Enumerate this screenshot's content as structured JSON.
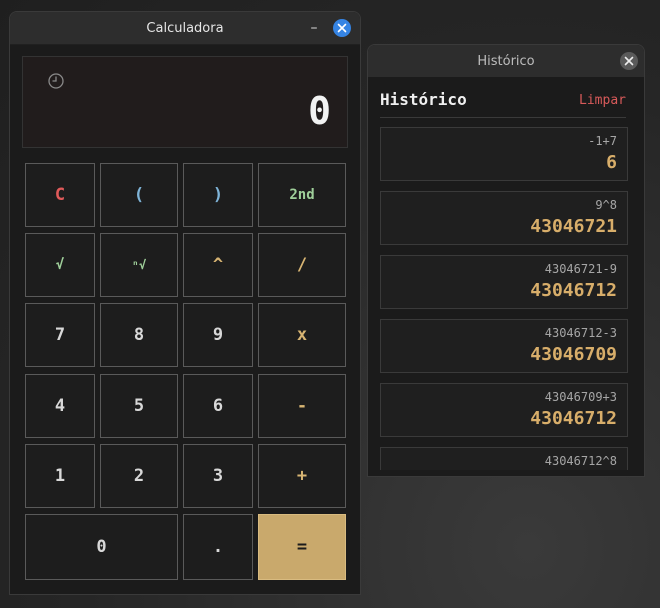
{
  "calculator": {
    "title": "Calculadora",
    "minimize_glyph": "–",
    "close_glyph": "✕",
    "display_value": "0",
    "history_icon": "clock-icon",
    "keys": {
      "clear": "C",
      "lparen": "(",
      "rparen": ")",
      "second": "2nd",
      "sqrt": "√",
      "nroot": "ⁿ√",
      "power": "^",
      "divide": "/",
      "seven": "7",
      "eight": "8",
      "nine": "9",
      "multiply": "x",
      "four": "4",
      "five": "5",
      "six": "6",
      "minus": "-",
      "one": "1",
      "two": "2",
      "three": "3",
      "plus": "+",
      "zero": "0",
      "dot": ".",
      "equals": "="
    }
  },
  "history": {
    "window_title": "Histórico",
    "close_glyph": "✕",
    "heading": "Histórico",
    "clear_label": "Limpar",
    "items": [
      {
        "expr": "-1+7",
        "result": "6"
      },
      {
        "expr": "9^8",
        "result": "43046721"
      },
      {
        "expr": "43046721-9",
        "result": "43046712"
      },
      {
        "expr": "43046712-3",
        "result": "43046709"
      },
      {
        "expr": "43046709+3",
        "result": "43046712"
      },
      {
        "expr": "43046712^8",
        "result": ""
      }
    ]
  },
  "colors": {
    "accent_gold": "#c9a96c",
    "clear_red": "#e05a5a",
    "close_blue": "#3584e4"
  }
}
